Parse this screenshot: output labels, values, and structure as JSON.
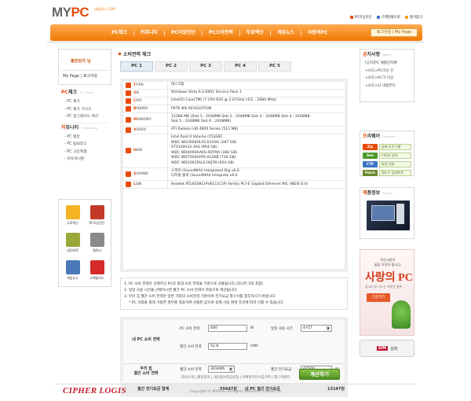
{
  "brand": {
    "logo_my": "MY",
    "logo_pc": "PC",
    "logo_small": "내컴퓨터\n.COM"
  },
  "top_links": [
    {
      "label": "PC이상진단",
      "color": "#e84b0b"
    },
    {
      "label": "구매현황조회",
      "color": "#3b74c0"
    },
    {
      "label": "즐겨찾기",
      "color": "#f0a000"
    }
  ],
  "nav": {
    "items": [
      "PC체크",
      "커뮤니티",
      "PC이상진단",
      "PC소비전력",
      "무료백신",
      "게임뉴스",
      "사랑의PC"
    ],
    "mypage_label": "로그아웃 | My Page"
  },
  "welcome": {
    "greeting": "불은감자 님",
    "links": "My Page | 로그아웃"
  },
  "sidemenu": {
    "pc_check": {
      "title_b": "PC",
      "title": "체크",
      "en": "PC Check",
      "items": [
        "- PC 체크",
        "- PC 체크 가이드",
        "- PC 업그레이드 체크"
      ]
    },
    "community": {
      "title_b": "커",
      "title": "뮤니티",
      "en": "Community",
      "items": [
        "- PC 랭킹",
        "- PC 팁&테크",
        "- PC 고민해결",
        "- 자유게시판"
      ]
    }
  },
  "icon_grid": [
    {
      "label": "무료백신",
      "color": "#f5b321",
      "icon": "vaccine-icon"
    },
    {
      "label": "PC이상진단",
      "color": "#c43a2a",
      "icon": "tools-icon"
    },
    {
      "label": "사랑의PC",
      "color": "#9aa83a",
      "icon": "donation-box-icon"
    },
    {
      "label": "캘린더",
      "color": "#8a8a8a",
      "icon": "calendar-icon"
    },
    {
      "label": "게임뉴스",
      "color": "#4a78b8",
      "icon": "game-news-icon"
    },
    {
      "label": "스펙플러스",
      "color": "#d42a2a",
      "icon": "spec-plus-icon"
    }
  ],
  "main": {
    "title": "소비전력 체크",
    "tabs": [
      "PC 1",
      "PC 2",
      "PC 3",
      "PC 4",
      "PC 5"
    ],
    "spec_rows": [
      {
        "label_o": "T",
        "label": "YPE",
        "icon": "type-icon",
        "color": "#e84b0b",
        "values": [
          "데스크탑"
        ]
      },
      {
        "label_o": "O",
        "label": "S",
        "icon": "os-icon",
        "color": "#e84b0b",
        "values": [
          "Windows Vista 6.0.6001 Service Pack 1"
        ]
      },
      {
        "label_o": "C",
        "label": "PU",
        "icon": "cpu-icon",
        "color": "#e84b0b",
        "values": [
          "Intel(R) Core(TM) i7 CPU 920 @ 2.67GHz (속도 : 2680 MHz)"
        ]
      },
      {
        "label_o": "B",
        "label": "OARD",
        "icon": "board-icon",
        "color": "#e84b0b",
        "values": [
          "P6T6 WS REVOLUTION"
        ]
      },
      {
        "label_o": "M",
        "label": "EMORY",
        "icon": "memory-icon",
        "color": "#e84b0b",
        "values": [
          "12288 MB (Slot 1 : 2048MB Slot 2 : 2048MB Slot 3 : 2048MB Slot 4 : 2048MB",
          "Slot 5 : 2048MB Slot 6 : 2048MB)"
        ]
      },
      {
        "label_o": "V",
        "label": "IDEO",
        "icon": "video-icon",
        "color": "#e84b0b",
        "values": [
          "ATI Radeon HD 4800 Series (512 MB)"
        ]
      },
      {
        "label_o": "H",
        "label": "DD",
        "icon": "hdd-icon",
        "color": "#e84b0b",
        "values": [
          "Intel Raid 0 Volume (153GB)",
          "WDC WD3000HLFS-01G6U (287 GB)",
          "ST3100033 3AS (954 GB)",
          "WDC WD4000AAKS-00TMA (382 GB)",
          "WDC WD7500AYPS-01ZKB (716 GB)",
          "WDC WD1001FALS-00J7B (954 GB)"
        ]
      },
      {
        "label_o": "S",
        "label": "OUND",
        "icon": "sound-icon",
        "color": "#e84b0b",
        "values": [
          "스피커 (SoundMAX Integrated Dig v6.6",
          "디지털 출력 (SoundMAX Integrate v6.6"
        ]
      },
      {
        "label_o": "L",
        "label": "AN",
        "icon": "lan-icon",
        "color": "#e84b0b",
        "values": [
          "Realtek RTL8168C(P)/8111C(P) Family PCI-E Gigabit Ethernet NIC (NDIS 6.0)"
        ]
      }
    ],
    "notes": [
      "1. PC 소비 전력은 선택하신 PC의 최대 소비 전력을 기준으로 산출됩니다.(모니터 1대 포함)",
      "2. 일일 사용 시간을 선택하시면 월간 PC 소비 전력이 자동으로 계산됩니다.",
      "3. 우리 집 월간 소비 전력은 일반 가정의 소비전력 기준이며 전기요금 청구서를 참조하시기 바랍니다.",
      "* PC 사양을 최대 가동한 경우를 적용하여 산출된 값으로 실제 사용 환경 조건에 따라 다를 수 있습니다."
    ],
    "calc": {
      "pc_label": "내 PC 소비 전력",
      "home_label": "우리 집\n월간 소비 전력",
      "pc_power_label": "PC 소비 전력",
      "pc_power_value": "440",
      "pc_power_unit": "W",
      "daily_label": "일일 사용 시간",
      "daily_value": "4시간",
      "monthly_label": "월간 소비 전력",
      "monthly_value": "52.8",
      "monthly_unit": "kWh",
      "home_power_label": "월간 소비 전력",
      "home_power_value": "301kWh",
      "home_bill_label": "월간 전기요금",
      "home_bill_value": "42500",
      "home_bill_unit": "원",
      "calc_button": "계산하기",
      "sum_label": "월간 전기요금 합계",
      "sum_value": "55647원",
      "mypc_label": "내 PC 월간 전기요금",
      "mypc_value": "13147원"
    }
  },
  "right": {
    "notice": {
      "title_b": "공",
      "title": "지사항",
      "en": "Notice",
      "items": [
        "[공지]PC 매출단지배",
        "<보도>PC이상 진",
        "<보도>PC가 이상",
        "<보도>난 내컴퓨터"
      ]
    },
    "freeware": {
      "title_b": "프",
      "title": "리웨어",
      "en": "Freeware",
      "items": [
        {
          "name": "Zip",
          "desc": "압축 도우그램",
          "color": "#e84b0b"
        },
        {
          "name": "See",
          "desc": "이미지 뷰어",
          "color": "#4a9a2a"
        },
        {
          "name": "FTP",
          "desc": "파일 전송",
          "color": "#3b74c0"
        },
        {
          "name": "Patch",
          "desc": "윈도우 업데이트",
          "color": "#6a8a2a"
        }
      ]
    },
    "product": {
      "title_b": "제",
      "title": "품정보",
      "en": "Product"
    },
    "banner_love": {
      "line1": "작은사랑이\n꿈을 이루어 줍니다.",
      "line2": "사랑의 PC",
      "line3": "중고PC로 나누는 따뜻한 행복",
      "button": "기증하기"
    },
    "banner_sim": {
      "sim": "SIM",
      "label": "심퍼"
    }
  },
  "footer": {
    "links": "회사소개 | 제휴문의 | 개인정보취급방침 | 이메일무단수집거부 | 맵고객센터",
    "logo": "CIPHER LOGIS",
    "copyright": "Copyright © MYPCIS. All Rights Reserved.   Contact us"
  }
}
